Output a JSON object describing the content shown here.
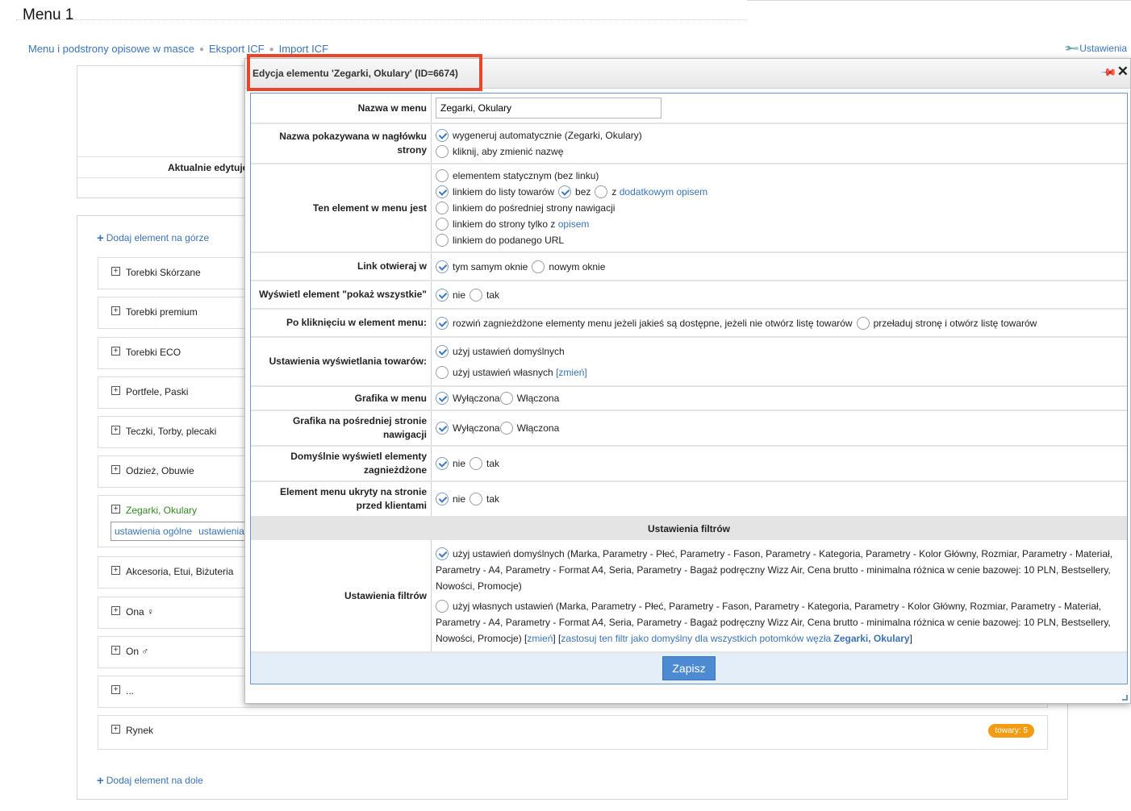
{
  "page": {
    "title": "Menu 1",
    "links": [
      "Menu i podstrony opisowe w masce",
      "Eksport ICF",
      "Import ICF"
    ],
    "settings_label": "Ustawienia"
  },
  "panel_top": {
    "aktualnie": "Aktualnie edytuje"
  },
  "menu_tree": {
    "add_top": "Dodaj element na górze",
    "add_bottom": "Dodaj element na dole",
    "items": [
      {
        "label": "Torebki Skórzane"
      },
      {
        "label": "Torebki premium"
      },
      {
        "label": "Torebki ECO"
      },
      {
        "label": "Portfele, Paski"
      },
      {
        "label": "Teczki, Torby, plecaki"
      },
      {
        "label": "Odzież, Obuwie"
      },
      {
        "label": "Zegarki, Okulary"
      },
      {
        "label": "Akcesoria, Etui, Biżuteria"
      },
      {
        "label": "Ona ♀"
      },
      {
        "label": "On ♂"
      },
      {
        "label": "..."
      },
      {
        "label": "Rynek"
      }
    ],
    "active_subtabs": [
      "ustawienia ogólne",
      "ustawienia"
    ],
    "badge": "towary: 5",
    "expand_glyph": "+"
  },
  "dialog": {
    "title": "Edycja elementu 'Zegarki, Okulary' (ID=6674)",
    "rows": {
      "nazwa": {
        "label": "Nazwa w menu",
        "value": "Zegarki, Okulary"
      },
      "naglowek": {
        "label": "Nazwa pokazywana w nagłówku strony",
        "opt1": "wygeneruj automatycznie (Zegarki, Okulary)",
        "opt2": "kliknij, aby zmienić nazwę"
      },
      "element": {
        "label": "Ten element w menu jest",
        "opt1": "elementem statycznym (bez linku)",
        "opt2": "linkiem do listy towarów",
        "opt2_bez": "bez",
        "opt2_z": "z",
        "opt2_link": "dodatkowym opisem",
        "opt3": "linkiem do pośredniej strony nawigacji",
        "opt4": "linkiem do strony tylko z",
        "opt4_link": "opisem",
        "opt5": "linkiem do podanego URL"
      },
      "link": {
        "label": "Link otwieraj w",
        "opt1": "tym samym oknie",
        "opt2": "nowym oknie"
      },
      "pokaz": {
        "label": "Wyświetl element \"pokaż wszystkie\"",
        "opt1": "nie",
        "opt2": "tak"
      },
      "klikniecie": {
        "label": "Po kliknięciu w element menu:",
        "opt1": "rozwiń zagnieżdżone elementy menu jeżeli jakieś są dostępne, jeżeli nie otwórz listę towarów",
        "opt2": "przeładuj stronę i otwórz listę towarów"
      },
      "wyswietlanie": {
        "label": "Ustawienia wyświetlania towarów:",
        "opt1": "użyj ustawień domyślnych",
        "opt2": "użyj ustawień własnych",
        "opt2_link": "[zmień]"
      },
      "grafika": {
        "label": "Grafika w menu",
        "opt1": "Wyłączona",
        "opt2": "Włączona"
      },
      "grafika_posr": {
        "label": "Grafika na pośredniej stronie nawigacji",
        "opt1": "Wyłączona",
        "opt2": "Włączona"
      },
      "zagniezdzone": {
        "label": "Domyślnie wyświetl elementy zagnieżdżone",
        "opt1": "nie",
        "opt2": "tak"
      },
      "ukryty": {
        "label": "Element menu ukryty na stronie przed klientami",
        "opt1": "nie",
        "opt2": "tak"
      }
    },
    "section_filters": "Ustawienia filtrów",
    "filters": {
      "label": "Ustawienia filtrów",
      "opt1": "użyj ustawień domyślnych (Marka, Parametry - Płeć, Parametry - Fason, Parametry - Kategoria, Parametry - Kolor Główny, Rozmiar, Parametry - Materiał, Parametry - A4, Parametry - Format A4, Seria, Parametry - Bagaż podręczny Wizz Air, Cena brutto - minimalna różnica w cenie bazowej: 10 PLN, Bestsellery, Nowości, Promocje)",
      "opt2": "użyj własnych ustawień (Marka, Parametry - Płeć, Parametry - Fason, Parametry - Kategoria, Parametry - Kolor Główny, Rozmiar, Parametry - Materiał, Parametry - A4, Parametry - Format A4, Seria, Parametry - Bagaż podręczny Wizz Air, Cena brutto - minimalna różnica w cenie bazowej: 10 PLN, Bestsellery, Nowości, Promocje)",
      "zmien": "zmień",
      "apply_text": "zastosuj ten filtr jako domyślny dla wszystkich potomków węzła",
      "apply_node": "Zegarki, Okulary"
    },
    "save_label": "Zapisz"
  }
}
